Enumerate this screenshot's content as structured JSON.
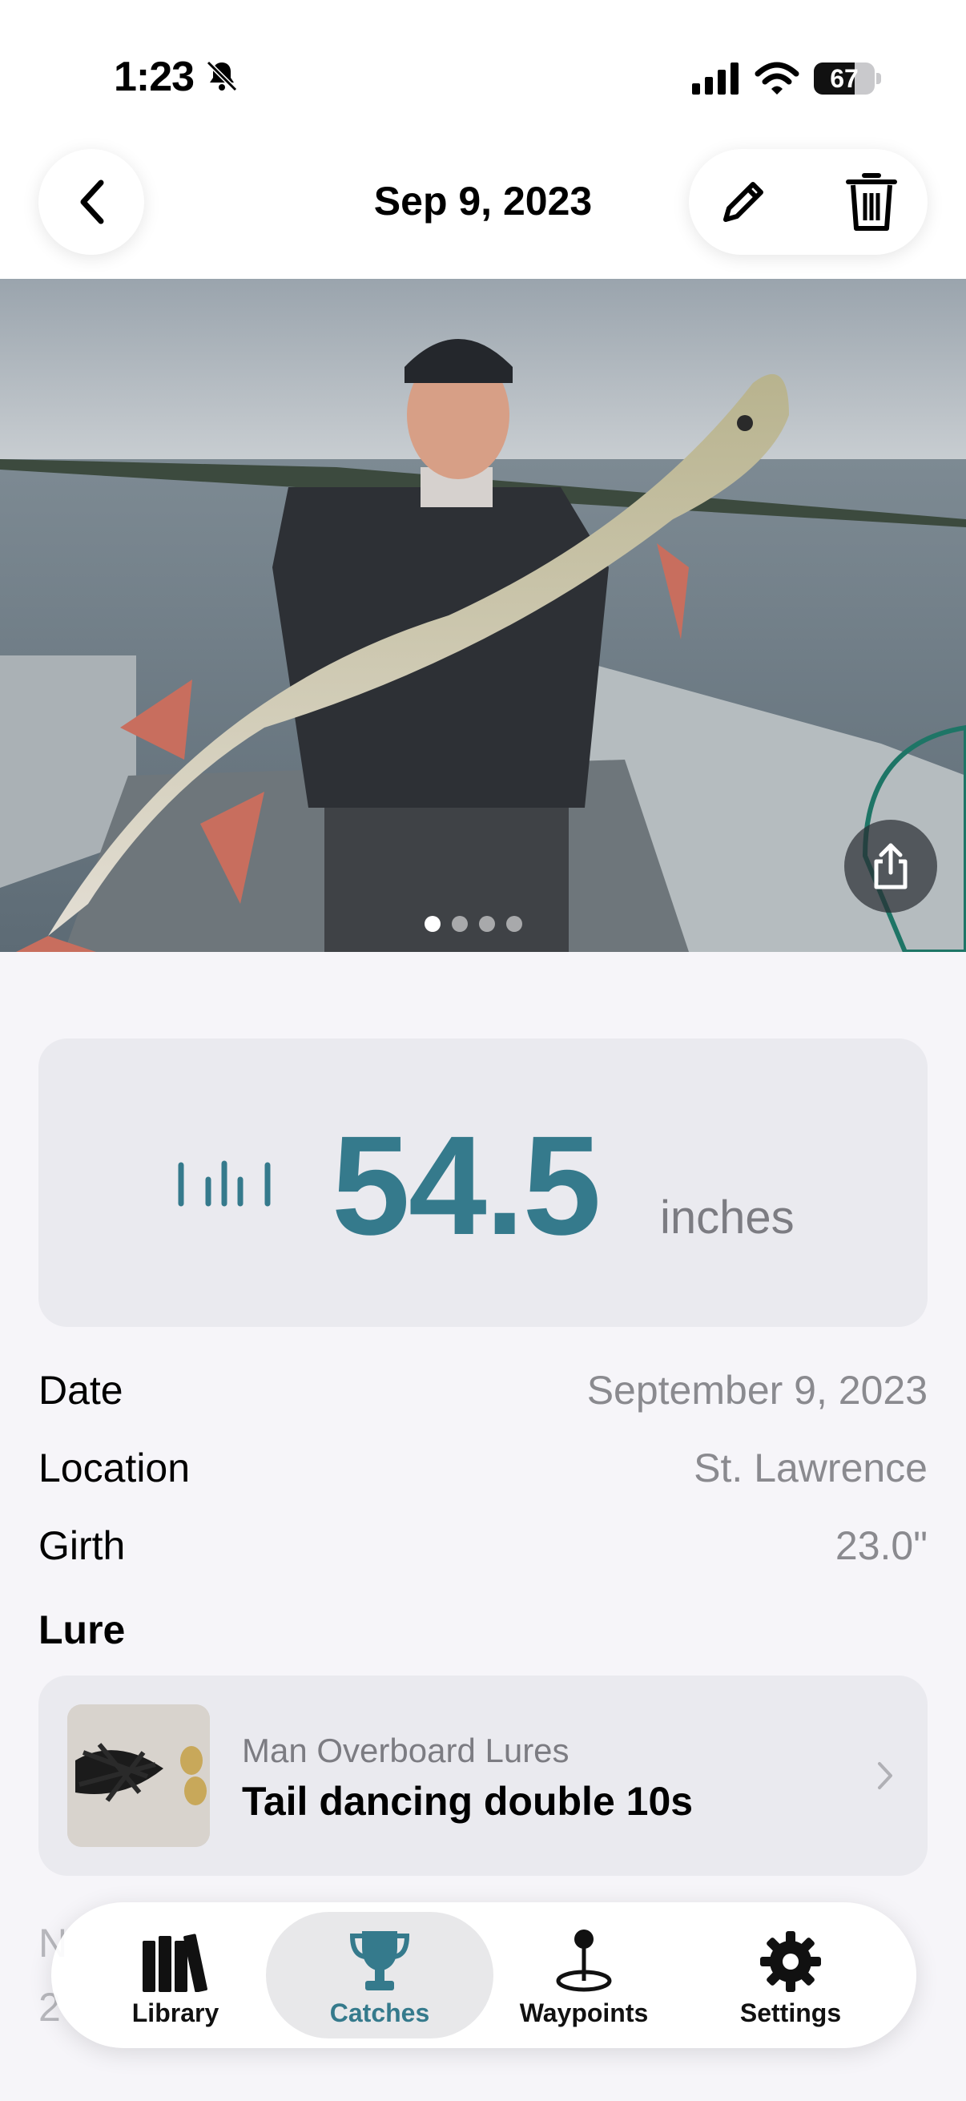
{
  "status_bar": {
    "time": "1:23",
    "battery": "67",
    "battery_level": 0.67,
    "silent_mode": true
  },
  "header": {
    "title": "Sep 9, 2023",
    "icons": [
      "chevron-left-icon",
      "pencil-icon",
      "trash-icon"
    ]
  },
  "photo": {
    "page_count": 4,
    "current_page": 1
  },
  "measurement": {
    "value": "54.5",
    "unit": "inches",
    "accent_color": "#357a8c"
  },
  "details": [
    {
      "label": "Date",
      "value": "September 9, 2023"
    },
    {
      "label": "Location",
      "value": "St. Lawrence"
    },
    {
      "label": "Girth",
      "value": "23.0\""
    }
  ],
  "lure": {
    "section_title": "Lure",
    "brand": "Man Overboard Lures",
    "name": "Tail dancing double 10s"
  },
  "peek": {
    "line1": "N",
    "line2": "2"
  },
  "tabs": [
    {
      "label": "Library",
      "icon": "books-icon",
      "active": false
    },
    {
      "label": "Catches",
      "icon": "trophy-icon",
      "active": true
    },
    {
      "label": "Waypoints",
      "icon": "map-pin-icon",
      "active": false
    },
    {
      "label": "Settings",
      "icon": "gear-icon",
      "active": false
    }
  ]
}
